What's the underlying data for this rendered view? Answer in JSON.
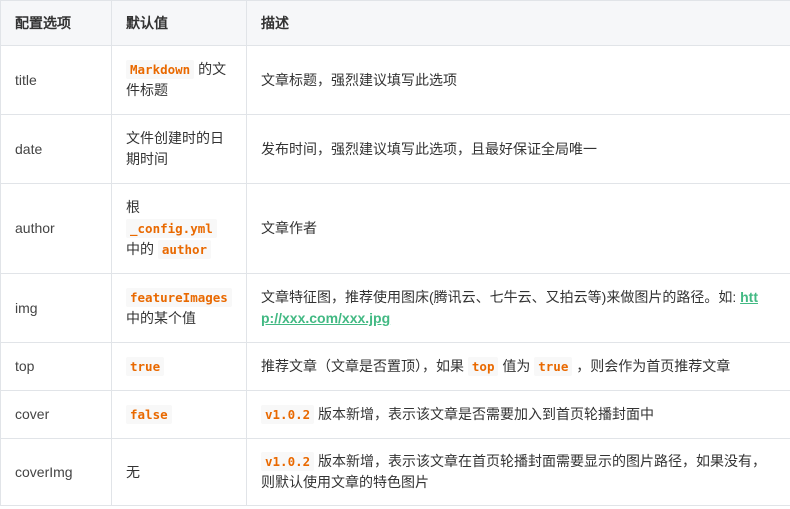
{
  "header": {
    "col1": "配置选项",
    "col2": "默认值",
    "col3": "描述"
  },
  "rows": {
    "title": {
      "option": "title",
      "default_code": "Markdown",
      "default_text": " 的文件标题",
      "desc": "文章标题，强烈建议填写此选项"
    },
    "date": {
      "option": "date",
      "default_text": "文件创建时的日期时间",
      "desc": "发布时间，强烈建议填写此选项，且最好保证全局唯一"
    },
    "author": {
      "option": "author",
      "default_pre": "根",
      "default_code1": "_config.yml",
      "default_mid": "中的",
      "default_code2": "author",
      "desc": "文章作者"
    },
    "img": {
      "option": "img",
      "default_code": "featureImages",
      "default_text": "中的某个值",
      "desc": "文章特征图，推荐使用图床(腾讯云、七牛云、又拍云等)来做图片的路径。如: ",
      "desc_link": "http://xxx.com/xxx.jpg"
    },
    "top": {
      "option": "top",
      "default_code": "true",
      "desc_a": "推荐文章（文章是否置顶），如果",
      "desc_code1": "top",
      "desc_b": "值为",
      "desc_code2": "true",
      "desc_c": "，则会作为首页推荐文章"
    },
    "cover": {
      "option": "cover",
      "default_code": "false",
      "desc_code": "v1.0.2",
      "desc_text": "版本新增，表示该文章是否需要加入到首页轮播封面中"
    },
    "coverImg": {
      "option": "coverImg",
      "default_text": "无",
      "desc_code": "v1.0.2",
      "desc_text": "版本新增，表示该文章在首页轮播封面需要显示的图片路径，如果没有，则默认使用文章的特色图片"
    }
  }
}
